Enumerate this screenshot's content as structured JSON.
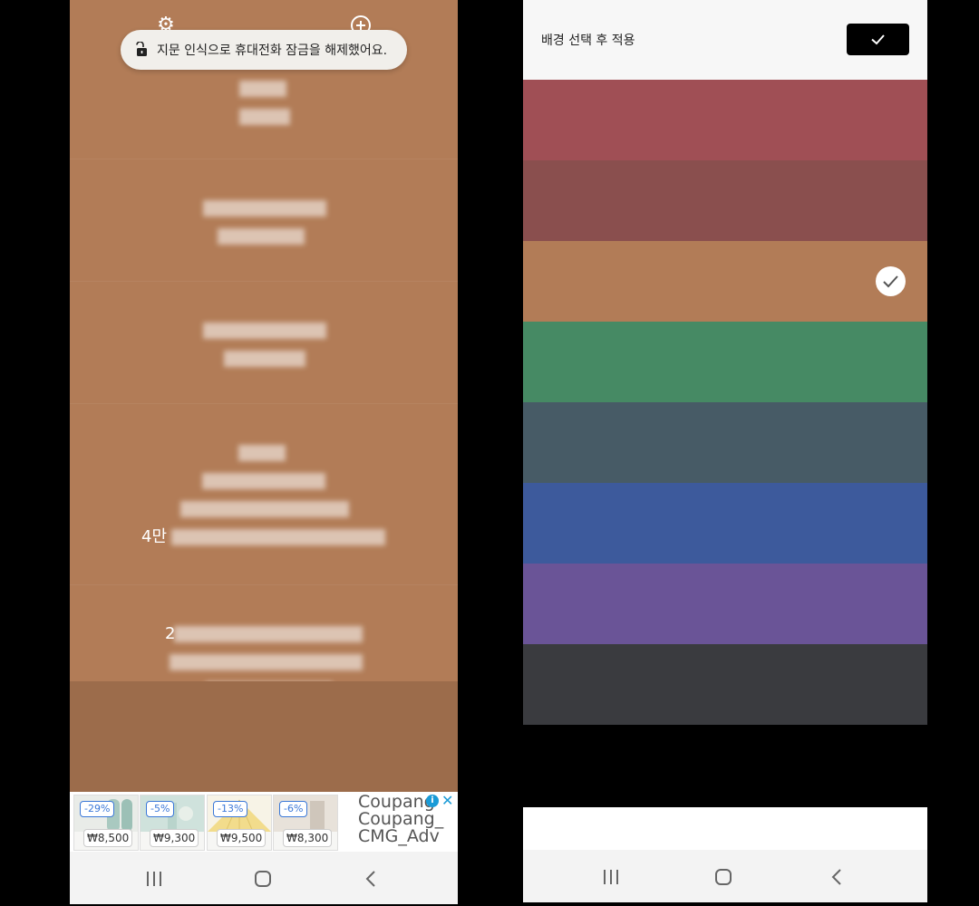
{
  "left_phone": {
    "toast": {
      "text": "지문 인식으로 휴대전화 잠금을 해제했어요."
    },
    "memos": [
      {
        "visible_prefix": ""
      },
      {
        "visible_prefix": ""
      },
      {
        "visible_prefix": ""
      },
      {
        "visible_prefix": "4만"
      },
      {
        "visible_prefix": "2"
      }
    ],
    "ads": [
      {
        "discount": "-29%",
        "price": "₩8,500"
      },
      {
        "discount": "-5%",
        "price": "₩9,300"
      },
      {
        "discount": "-13%",
        "price": "₩9,500"
      },
      {
        "discount": "-6%",
        "price": "₩8,300"
      }
    ],
    "ad_text": [
      "Coupang",
      "Coupang_",
      "CMG_Adv"
    ],
    "ad_info_label": "i"
  },
  "right_phone": {
    "header_title": "배경 선택 후 적용",
    "colors": [
      "#a04f55",
      "#8a4f4e",
      "#b27c57",
      "#468a64",
      "#475b66",
      "#3d5a9c",
      "#6a5497",
      "#3a3b3f"
    ],
    "selected_index": 2
  }
}
